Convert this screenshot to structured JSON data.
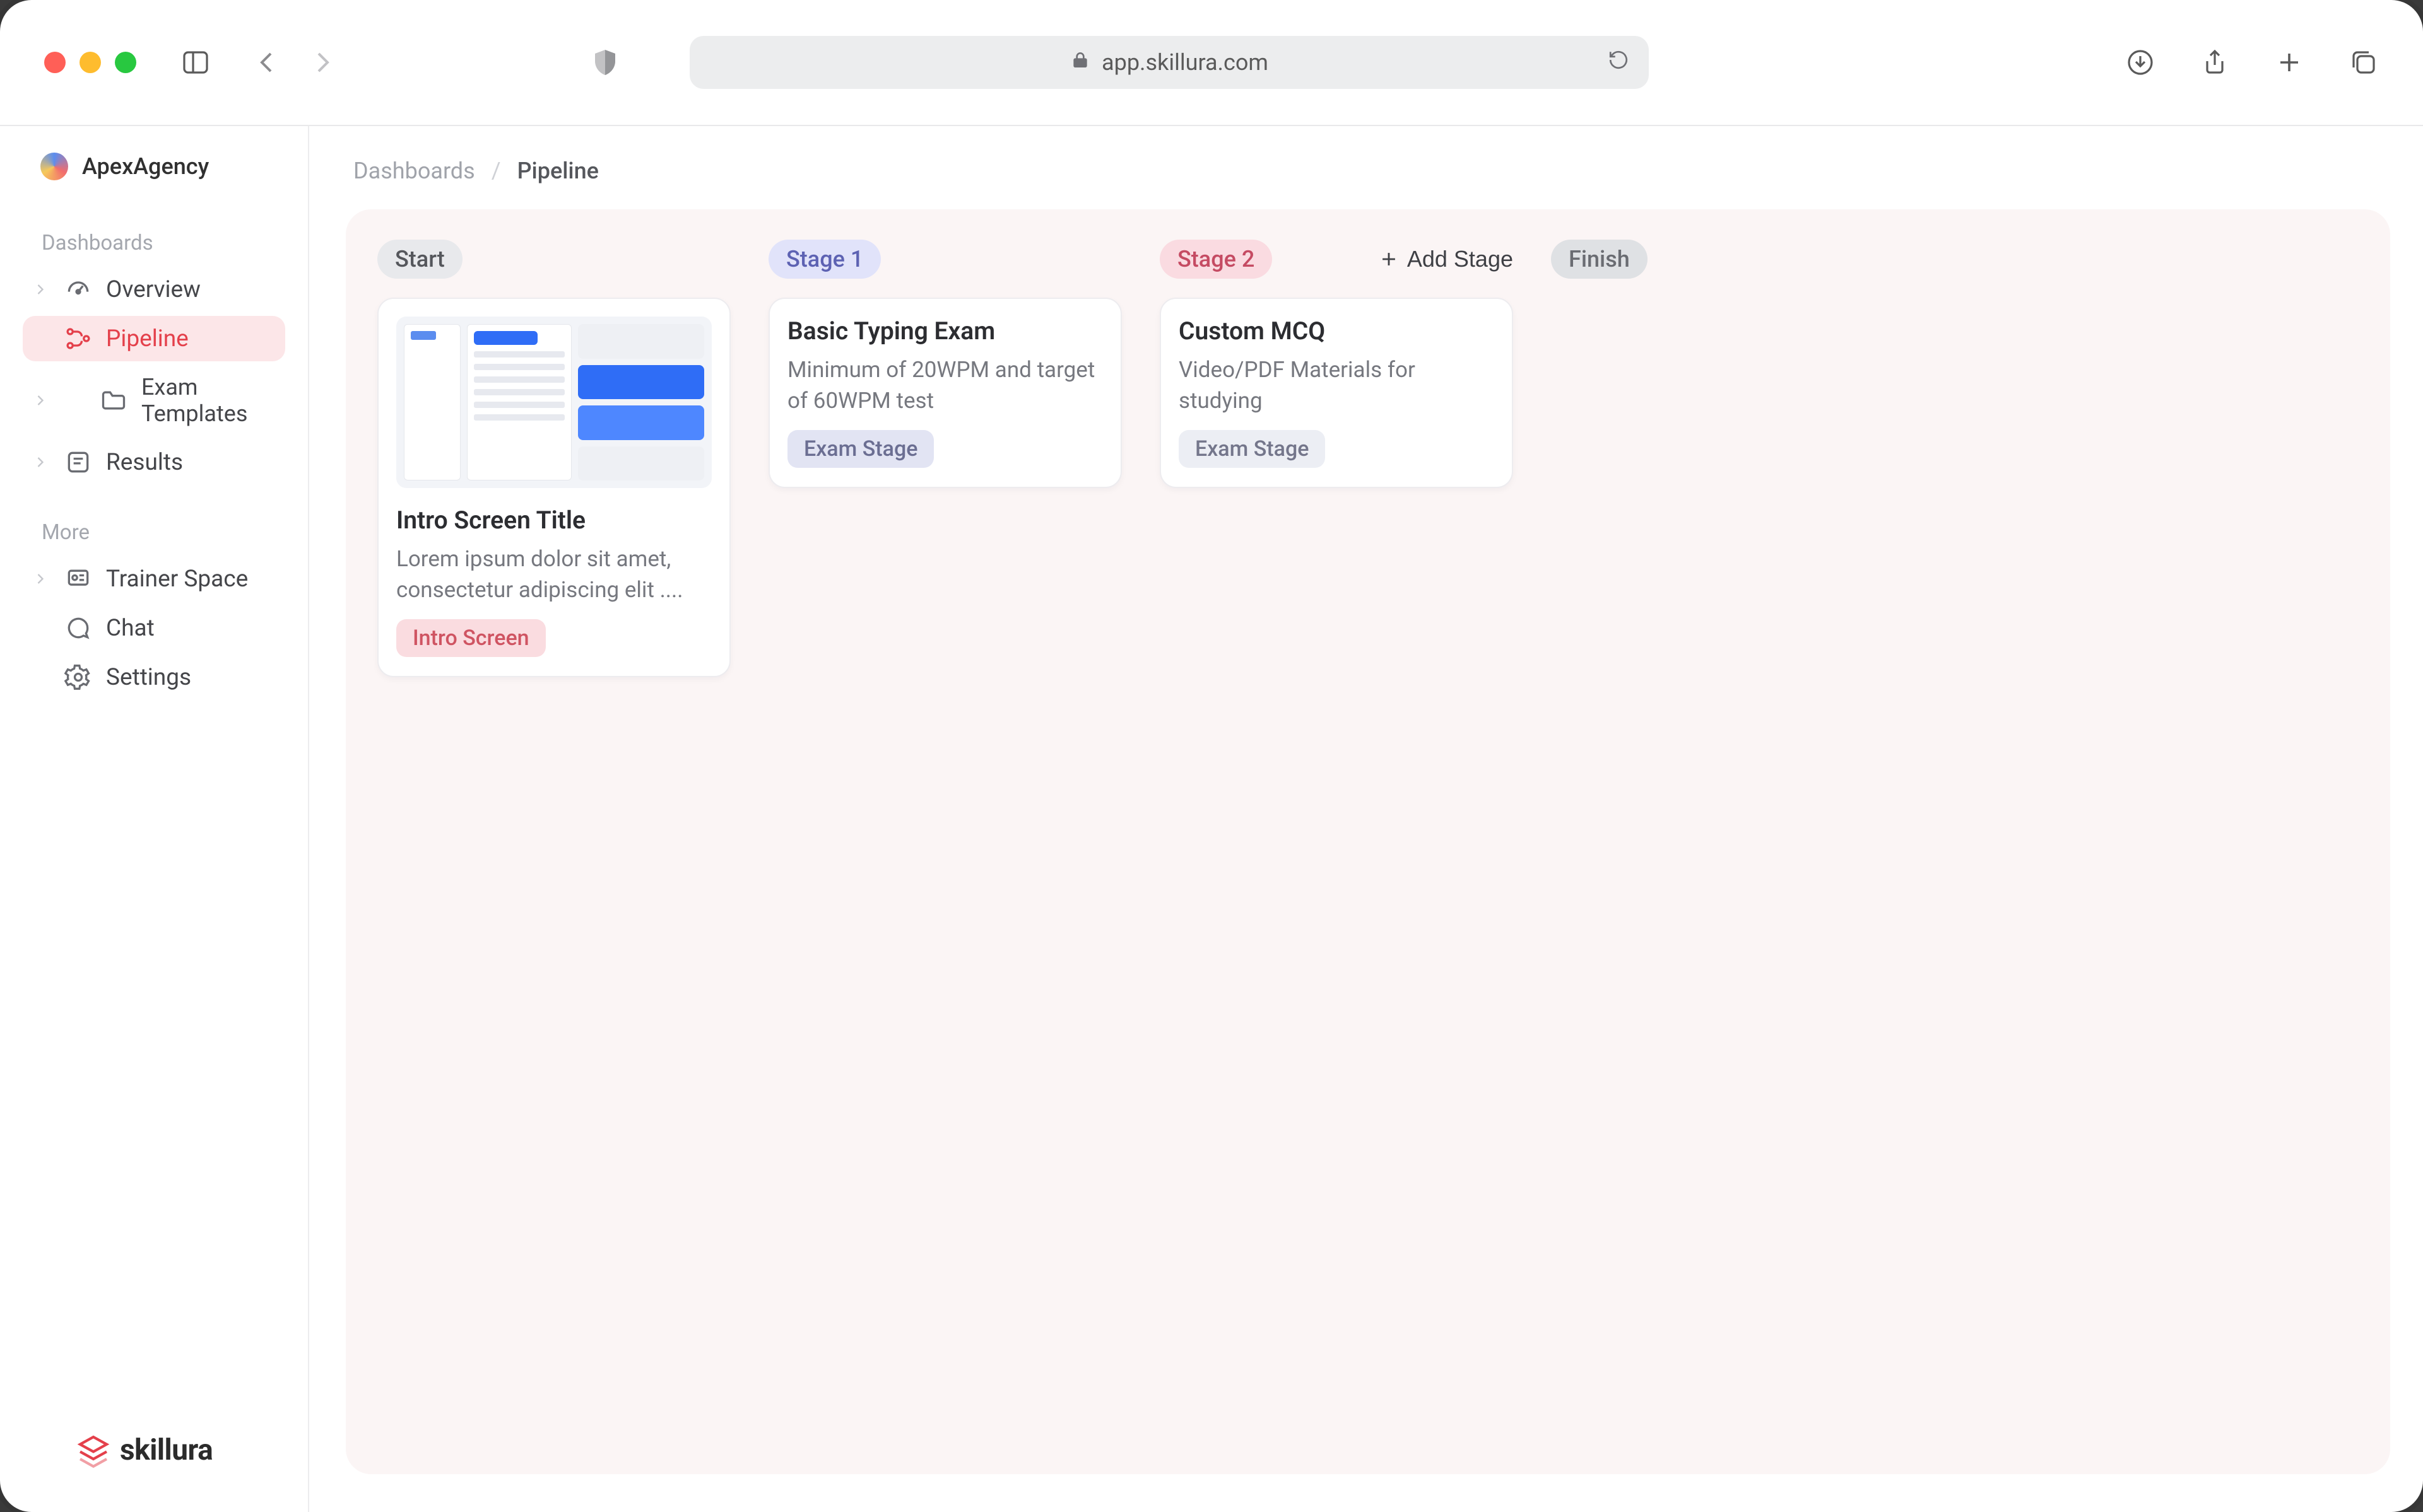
{
  "browser": {
    "url_display": "app.skillura.com"
  },
  "workspace": {
    "name": "ApexAgency"
  },
  "sidebar": {
    "sections": {
      "dashboards_label": "Dashboards",
      "more_label": "More"
    },
    "items": {
      "overview": {
        "label": "Overview"
      },
      "pipeline": {
        "label": "Pipeline"
      },
      "exam_templates": {
        "label": "Exam Templates"
      },
      "results": {
        "label": "Results"
      },
      "trainer_space": {
        "label": "Trainer Space"
      },
      "chat": {
        "label": "Chat"
      },
      "settings": {
        "label": "Settings"
      }
    }
  },
  "brand": {
    "name": "skillura"
  },
  "breadcrumbs": {
    "root": "Dashboards",
    "current": "Pipeline"
  },
  "board": {
    "add_stage_label": "Add Stage",
    "lanes": {
      "start": {
        "pill": "Start"
      },
      "stage1": {
        "pill": "Stage 1"
      },
      "stage2": {
        "pill": "Stage 2"
      },
      "finish": {
        "pill": "Finish"
      }
    },
    "cards": {
      "intro": {
        "title": "Intro Screen Title",
        "desc": "Lorem ipsum dolor sit amet, consectetur adipiscing elit ....",
        "tag": "Intro Screen"
      },
      "typing": {
        "title": "Basic Typing Exam",
        "desc": "Minimum of 20WPM and target of 60WPM test",
        "tag": "Exam Stage"
      },
      "mcq": {
        "title": "Custom MCQ",
        "desc": "Video/PDF Materials for studying",
        "tag": "Exam Stage"
      }
    }
  }
}
